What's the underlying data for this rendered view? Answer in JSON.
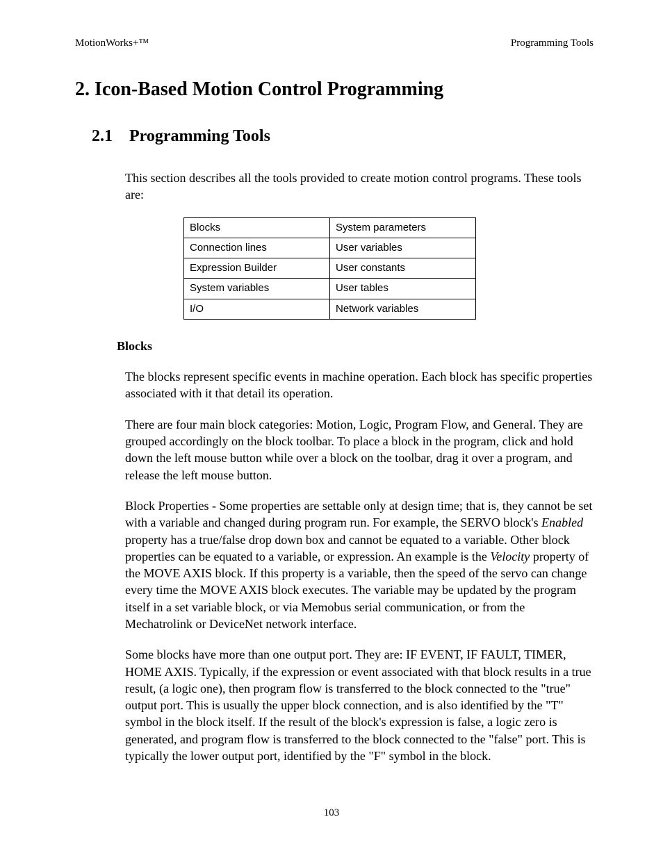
{
  "header": {
    "left": "MotionWorks+™",
    "right": "Programming Tools"
  },
  "chapter": {
    "title": "2. Icon-Based Motion Control Programming"
  },
  "section": {
    "number": "2.1",
    "title": "Programming Tools"
  },
  "intro": "This section describes all the tools provided to create motion control programs.  These tools are:",
  "tools_table": {
    "rows": [
      {
        "left": "Blocks",
        "right": "System parameters"
      },
      {
        "left": "Connection lines",
        "right": "User variables"
      },
      {
        "left": "Expression Builder",
        "right": "User constants"
      },
      {
        "left": "System variables",
        "right": "User tables"
      },
      {
        "left": "I/O",
        "right": "Network variables"
      }
    ]
  },
  "blocks_section": {
    "heading": "Blocks",
    "p1": "The blocks represent specific events in machine operation.  Each block has specific properties associated with it that detail its operation.",
    "p2": "There are four main block categories: Motion, Logic, Program Flow, and General.  They are grouped accordingly on the block toolbar.  To place a block in the program, click and hold down the left mouse button while over a block on the toolbar, drag it over a program, and release the left mouse button.",
    "p3_pre": "Block Properties - Some properties are settable only at design time; that is, they cannot be set with a variable and changed during program run.  For example, the SERVO block's ",
    "p3_em1": "Enabled",
    "p3_mid": " property has a true/false drop down box and cannot be equated to a variable.  Other block properties can be equated to a variable, or expression.  An example is the ",
    "p3_em2": "Velocity",
    "p3_post": " property of the MOVE AXIS block.  If  this property is a variable, then the speed of the servo can change every time the MOVE AXIS block executes.  The variable may be updated by the program itself in a set variable block, or via Memobus serial communication, or from the Mechatrolink or DeviceNet network interface.",
    "p4": "Some blocks have more than one output port.  They are: IF EVENT, IF FAULT, TIMER, HOME AXIS.  Typically, if the expression or event associated with that block results in a true result, (a logic one), then program flow is transferred to the block connected to the \"true\" output port.  This is usually the upper block connection, and is also identified by the \"T\" symbol in the block itself.  If  the result of the block's expression is false, a logic zero is generated, and program flow is transferred to the block connected to the \"false\" port.  This is typically the lower output port, identified by the \"F\" symbol in the block."
  },
  "page_number": "103"
}
